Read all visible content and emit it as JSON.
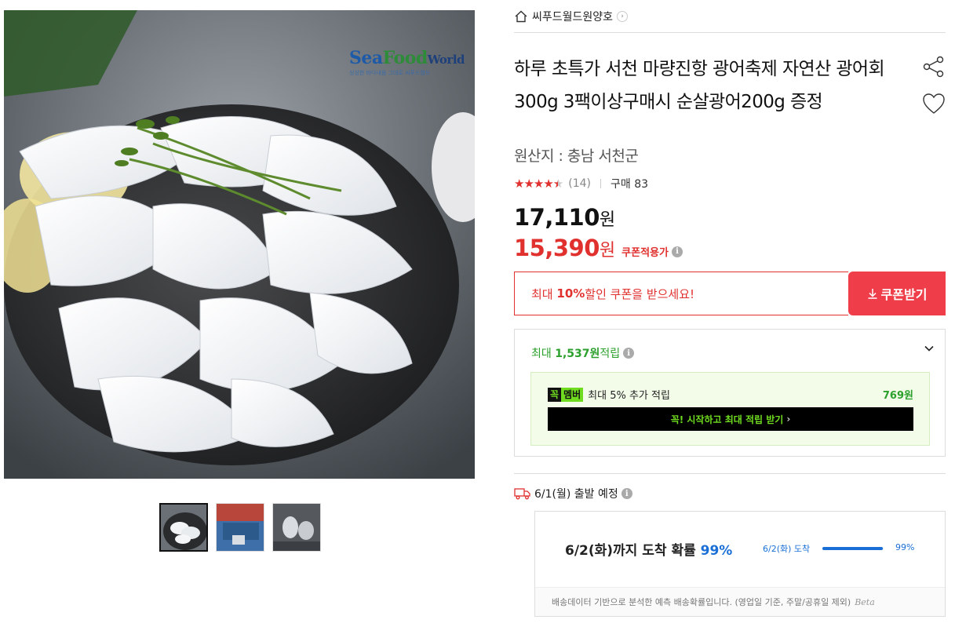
{
  "gallery": {
    "brand_logo": {
      "sea": "Sea",
      "food": "Food",
      "world": "World",
      "tagline": "싱싱한 바다내음 그대로 씨푸드월드"
    },
    "thumbnails": [
      {
        "name": "thumb-1",
        "active": true
      },
      {
        "name": "thumb-2",
        "active": false
      },
      {
        "name": "thumb-3",
        "active": false
      }
    ]
  },
  "store": {
    "name": "씨푸드월드원양호",
    "icon": "home-icon"
  },
  "product": {
    "title": "하루 초특가 서천 마량진항 광어축제 자연산 광어회 300g 3팩이상구매시 순살광어200g 증정",
    "origin": "원산지 : 충남 서천군",
    "rating": {
      "stars": 4.5,
      "count_label": "(14)",
      "purchase_label": "구매 83"
    },
    "price": {
      "original_number": "17,110",
      "sale_number": "15,390",
      "currency": "원",
      "coupon_applied_label": "쿠폰적용가"
    }
  },
  "coupon": {
    "msg_prefix": "최대 ",
    "msg_bold": "10%",
    "msg_suffix": " 할인 쿠폰을 받으세요!",
    "button_label": "쿠폰받기"
  },
  "points": {
    "head_prefix": "최대 ",
    "head_bold": "1,537원",
    "head_suffix": " 적립",
    "member": {
      "badge_1": "꼭",
      "badge_2": "멤버",
      "text": "최대 5% 추가 적립",
      "amount": "769원",
      "button_label": "꼭! 시작하고 최대 적립 받기"
    }
  },
  "shipping": {
    "departure": "6/1(월) 출발 예정",
    "arrival_prefix": "6/2(화)까지 도착 확률 ",
    "arrival_pct": "99%",
    "bar_label": "6/2(화) 도착",
    "bar_pct_label": "99%",
    "bar_fraction": 0.99,
    "footnote": "배송데이터 기반으로 분석한 예측 배송확률입니다. (영업일 기준, 주말/공휴일 제외)",
    "beta": "Beta"
  },
  "colors": {
    "accent_red": "#e0312f",
    "coupon_button": "#ef3e4a",
    "points_green": "#2ca02c",
    "member_green": "#6fdc1f",
    "arrival_blue": "#1a6fd6"
  }
}
